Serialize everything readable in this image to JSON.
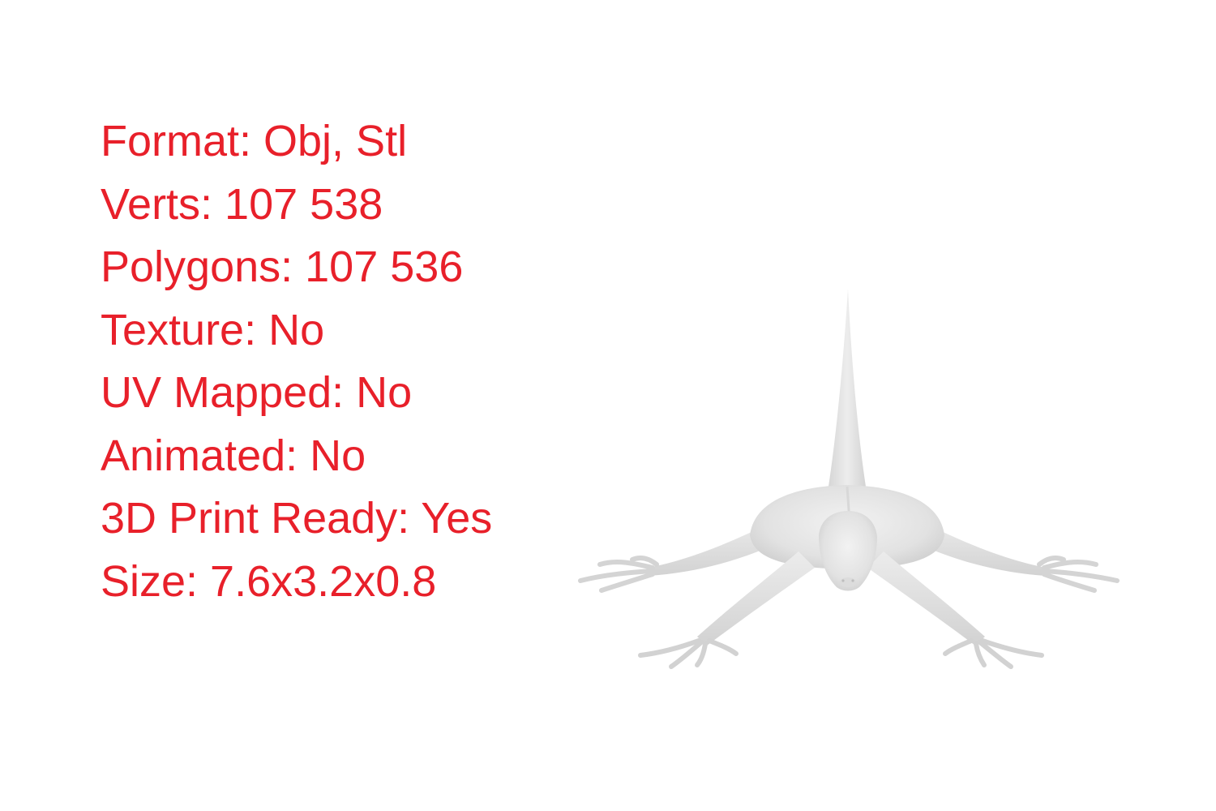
{
  "specs": [
    "Format: Obj, Stl",
    "Verts: 107 538",
    "Polygons: 107 536",
    "Texture: No",
    "UV Mapped: No",
    "Animated: No",
    "3D Print Ready: Yes",
    "Size: 7.6x3.2x0.8"
  ],
  "colors": {
    "text": "#e8202a",
    "model": "#e6e6e6",
    "background": "#ffffff"
  },
  "model_icon": "lizard-3d-model-icon"
}
